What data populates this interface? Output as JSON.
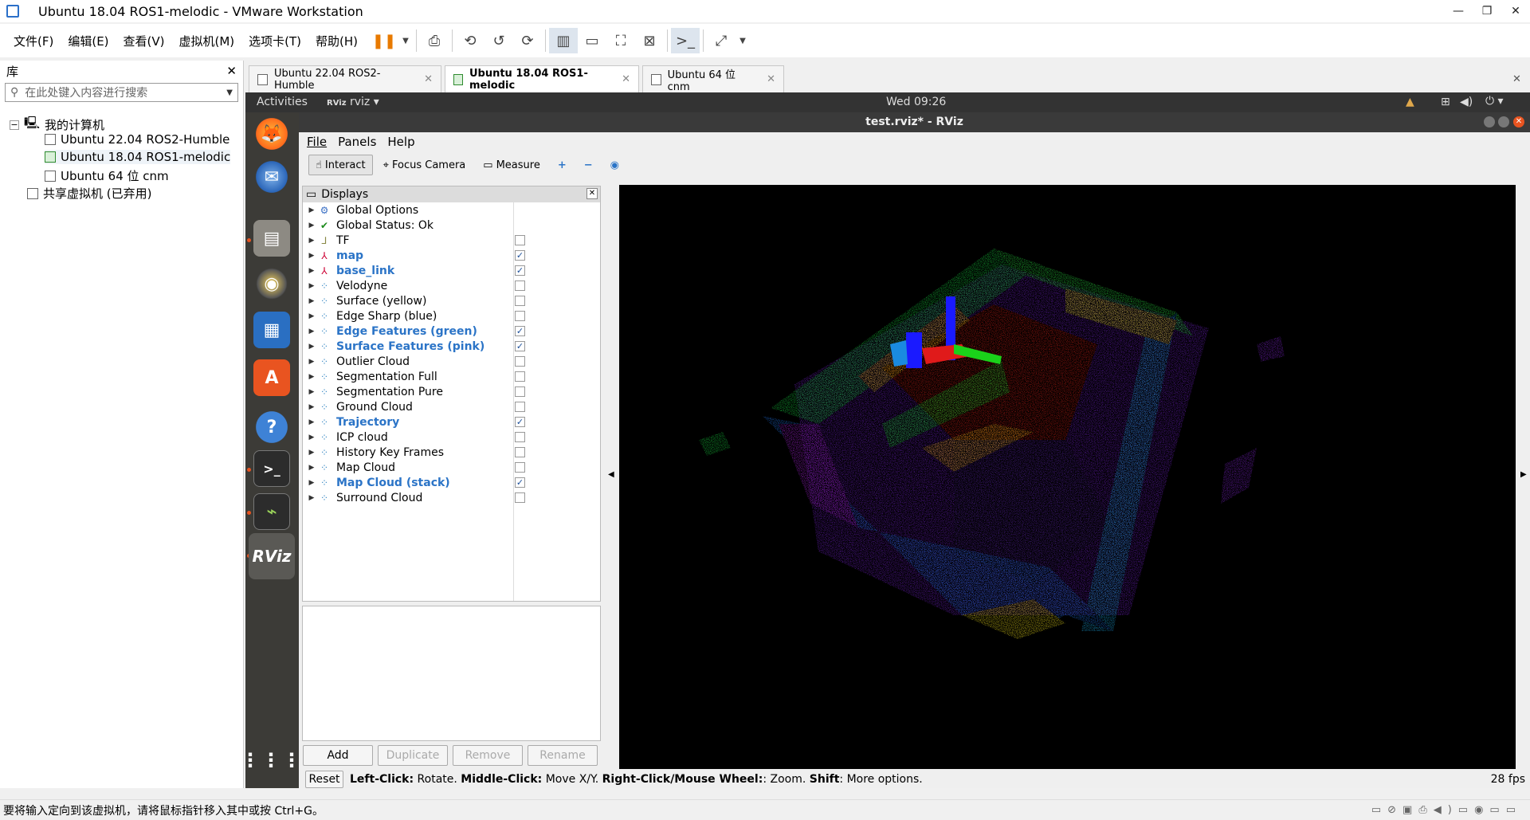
{
  "window": {
    "title": "Ubuntu 18.04 ROS1-melodic - VMware Workstation"
  },
  "menubar": {
    "items": [
      "文件(F)",
      "编辑(E)",
      "查看(V)",
      "虚拟机(M)",
      "选项卡(T)",
      "帮助(H)"
    ]
  },
  "library": {
    "title": "库",
    "search_placeholder": "在此处键入内容进行搜索",
    "root": "我的计算机",
    "vms": [
      "Ubuntu 22.04 ROS2-Humble",
      "Ubuntu 18.04 ROS1-melodic",
      "Ubuntu 64 位 cnm"
    ],
    "shared": "共享虚拟机 (已弃用)"
  },
  "tabs": [
    {
      "label": "Ubuntu 22.04 ROS2-Humble"
    },
    {
      "label": "Ubuntu 18.04 ROS1-melodic"
    },
    {
      "label": "Ubuntu 64 位 cnm"
    }
  ],
  "gnome": {
    "activities": "Activities",
    "app": "rviz",
    "clock": "Wed 09:26"
  },
  "rviz": {
    "title": "test.rviz* - RViz",
    "menu": [
      "File",
      "Panels",
      "Help"
    ],
    "tools": [
      "Interact",
      "Focus Camera",
      "Measure"
    ],
    "displays_title": "Displays",
    "displays": [
      {
        "label": "Global Options",
        "icon": "gear-icon",
        "checked": null,
        "bold": false
      },
      {
        "label": "Global Status: Ok",
        "icon": "check-icon",
        "checked": null,
        "bold": false
      },
      {
        "label": "TF",
        "icon": "tf-icon",
        "checked": false,
        "bold": false
      },
      {
        "label": "map",
        "icon": "axes-icon",
        "checked": true,
        "bold": true
      },
      {
        "label": "base_link",
        "icon": "axes-icon",
        "checked": true,
        "bold": true
      },
      {
        "label": "Velodyne",
        "icon": "pointcloud-icon",
        "checked": false,
        "bold": false
      },
      {
        "label": "Surface (yellow)",
        "icon": "pointcloud-icon",
        "checked": false,
        "bold": false
      },
      {
        "label": "Edge Sharp (blue)",
        "icon": "pointcloud-icon",
        "checked": false,
        "bold": false
      },
      {
        "label": "Edge Features (green)",
        "icon": "pointcloud-icon",
        "checked": true,
        "bold": true
      },
      {
        "label": "Surface Features (pink)",
        "icon": "pointcloud-icon",
        "checked": true,
        "bold": true
      },
      {
        "label": "Outlier Cloud",
        "icon": "pointcloud-icon",
        "checked": false,
        "bold": false
      },
      {
        "label": "Segmentation Full",
        "icon": "pointcloud-icon",
        "checked": false,
        "bold": false
      },
      {
        "label": "Segmentation Pure",
        "icon": "pointcloud-icon",
        "checked": false,
        "bold": false
      },
      {
        "label": "Ground Cloud",
        "icon": "pointcloud-icon",
        "checked": false,
        "bold": false
      },
      {
        "label": "Trajectory",
        "icon": "pointcloud-icon",
        "checked": true,
        "bold": true
      },
      {
        "label": "ICP cloud",
        "icon": "pointcloud-icon",
        "checked": false,
        "bold": false
      },
      {
        "label": "History Key Frames",
        "icon": "pointcloud-icon",
        "checked": false,
        "bold": false
      },
      {
        "label": "Map Cloud",
        "icon": "pointcloud-icon",
        "checked": false,
        "bold": false
      },
      {
        "label": "Map Cloud (stack)",
        "icon": "pointcloud-icon",
        "checked": true,
        "bold": true
      },
      {
        "label": "Surround Cloud",
        "icon": "pointcloud-icon",
        "checked": false,
        "bold": false
      }
    ],
    "buttons": {
      "add": "Add",
      "duplicate": "Duplicate",
      "remove": "Remove",
      "rename": "Rename"
    },
    "status": {
      "reset": "Reset",
      "left_click": "Left-Click:",
      "left_click_action": "Rotate.",
      "middle_click": "Middle-Click:",
      "middle_click_action": "Move X/Y.",
      "right_click": "Right-Click/Mouse Wheel:",
      "right_click_action": ": Zoom.",
      "shift": "Shift",
      "shift_action": ": More options.",
      "fps": "28 fps"
    }
  },
  "bottom_status": "要将输入定向到该虚拟机，请将鼠标指针移入其中或按 Ctrl+G。"
}
